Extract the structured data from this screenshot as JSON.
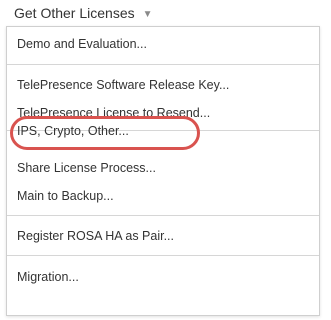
{
  "dropdown": {
    "label": "Get Other Licenses",
    "caret_icon": "caret-down-icon"
  },
  "menu": {
    "items": [
      {
        "label": "Demo and Evaluation..."
      },
      {
        "label": "TelePresence Software Release Key..."
      },
      {
        "label": "TelePresence License to Resend..."
      },
      {
        "label": "IPS, Crypto, Other..."
      },
      {
        "label": "Share License Process..."
      },
      {
        "label": "Main to Backup..."
      },
      {
        "label": "Register ROSA HA as Pair..."
      },
      {
        "label": "Migration..."
      }
    ],
    "highlighted_item": "IPS, Crypto, Other...",
    "highlight_color": "#d9534f"
  }
}
